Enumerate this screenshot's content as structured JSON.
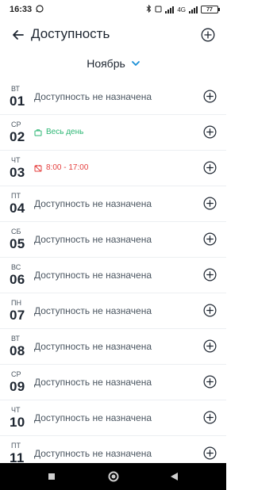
{
  "status_bar": {
    "time": "16:33",
    "battery": "77",
    "network_label": "4G"
  },
  "header": {
    "title": "Доступность"
  },
  "month": {
    "label": "Ноябрь"
  },
  "colors": {
    "accent": "#1a8fd6",
    "green": "#2bb673",
    "red": "#e5403f",
    "text": "#1d2530"
  },
  "days": [
    {
      "dow": "ВТ",
      "num": "01",
      "type": "none",
      "text": "Доступность не назначена"
    },
    {
      "dow": "СР",
      "num": "02",
      "type": "allday",
      "text": "Весь день"
    },
    {
      "dow": "ЧТ",
      "num": "03",
      "type": "time",
      "text": "8:00 - 17:00"
    },
    {
      "dow": "ПТ",
      "num": "04",
      "type": "none",
      "text": "Доступность не назначена"
    },
    {
      "dow": "СБ",
      "num": "05",
      "type": "none",
      "text": "Доступность не назначена"
    },
    {
      "dow": "ВС",
      "num": "06",
      "type": "none",
      "text": "Доступность не назначена"
    },
    {
      "dow": "ПН",
      "num": "07",
      "type": "none",
      "text": "Доступность не назначена"
    },
    {
      "dow": "ВТ",
      "num": "08",
      "type": "none",
      "text": "Доступность не назначена"
    },
    {
      "dow": "СР",
      "num": "09",
      "type": "none",
      "text": "Доступность не назначена"
    },
    {
      "dow": "ЧТ",
      "num": "10",
      "type": "none",
      "text": "Доступность не назначена"
    },
    {
      "dow": "ПТ",
      "num": "11",
      "type": "none",
      "text": "Доступность не назначена"
    }
  ]
}
